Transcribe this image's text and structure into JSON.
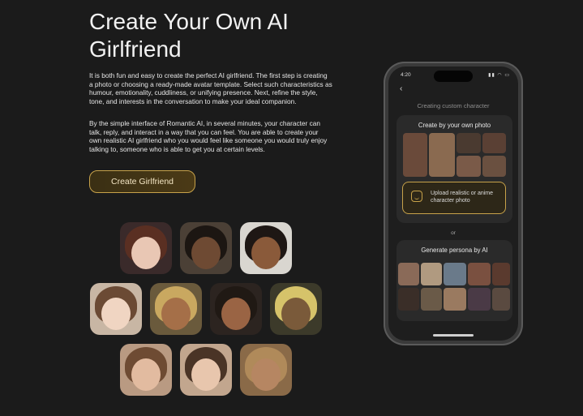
{
  "page": {
    "title": "Create Your Own AI Girlfriend",
    "paragraph_1": "It is both fun and easy to create the perfect AI girlfriend. The first step is creating a photo or choosing a ready-made avatar template. Select such characteristics as humour, emotionality, cuddliness, or unifying presence. Next, refine the style, tone, and interests in the conversation to make your ideal companion.",
    "paragraph_2": "By the simple interface of Romantic AI, in several minutes, your character can talk, reply, and interact in a way that you can feel. You are able to create your own realistic AI girlfriend who you would feel like someone you would truly enjoy talking to, someone who is able to get you at certain levels.",
    "cta_label": "Create Girlfriend"
  },
  "phone": {
    "status_time": "4:20",
    "status_icons": "▮▮ ◠ ▭",
    "back_glyph": "‹",
    "screen_title": "Creating custom character",
    "photo_card_title": "Create by your own photo",
    "upload_label": "Upload realistic or anime character photo",
    "or_label": "or",
    "persona_card_title": "Generate persona by AI"
  },
  "colors": {
    "background": "#1b1b1b",
    "accent_gold": "#c7a24a",
    "card": "#2a2a2a"
  }
}
